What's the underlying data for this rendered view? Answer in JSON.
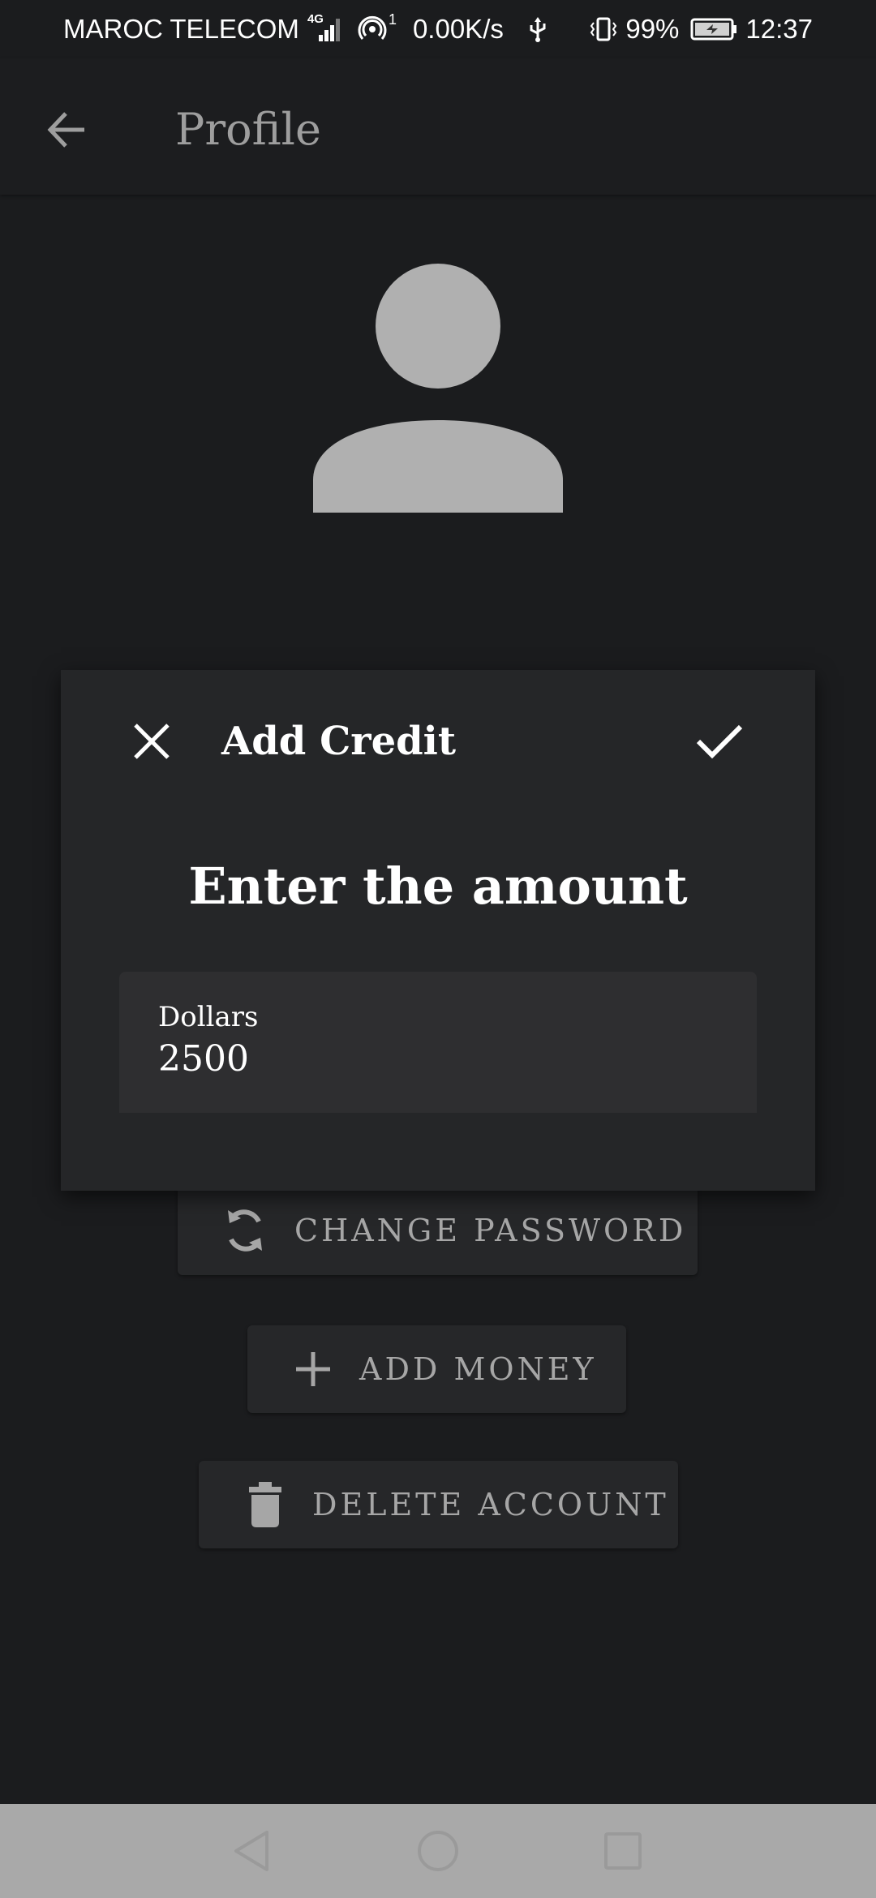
{
  "status_bar": {
    "carrier": "MAROC TELECOM",
    "network_type": "4G",
    "hotspot_count": "1",
    "speed": "0.00K/s",
    "battery": "99%",
    "time": "12:37",
    "icons": [
      "signal-icon",
      "hotspot-icon",
      "usb-icon",
      "vibrate-icon",
      "battery-charging-icon"
    ]
  },
  "app_bar": {
    "title": "Profile",
    "back_icon": "arrow-back-icon"
  },
  "avatar": {
    "icon": "person-icon",
    "color": "#b0b0b0"
  },
  "buttons": {
    "change_password": {
      "label": "CHANGE PASSWORD",
      "icon": "refresh-icon"
    },
    "add_money": {
      "label": "ADD MONEY",
      "icon": "plus-icon"
    },
    "delete_account": {
      "label": "DELETE ACCOUNT",
      "icon": "trash-icon"
    }
  },
  "dialog": {
    "title": "Add Credit",
    "close_icon": "close-icon",
    "confirm_icon": "check-icon",
    "heading": "Enter the amount",
    "field": {
      "label": "Dollars",
      "value": "2500"
    }
  },
  "nav_bar": {
    "icons": [
      "nav-back-icon",
      "nav-home-icon",
      "nav-recent-icon"
    ]
  },
  "colors": {
    "background": "#1b1c1e",
    "dialog": "#252628",
    "field": "#2e2e30",
    "button": "#262729",
    "muted_text": "#a6a6a6",
    "nav_bar": "#a9a9a9"
  }
}
